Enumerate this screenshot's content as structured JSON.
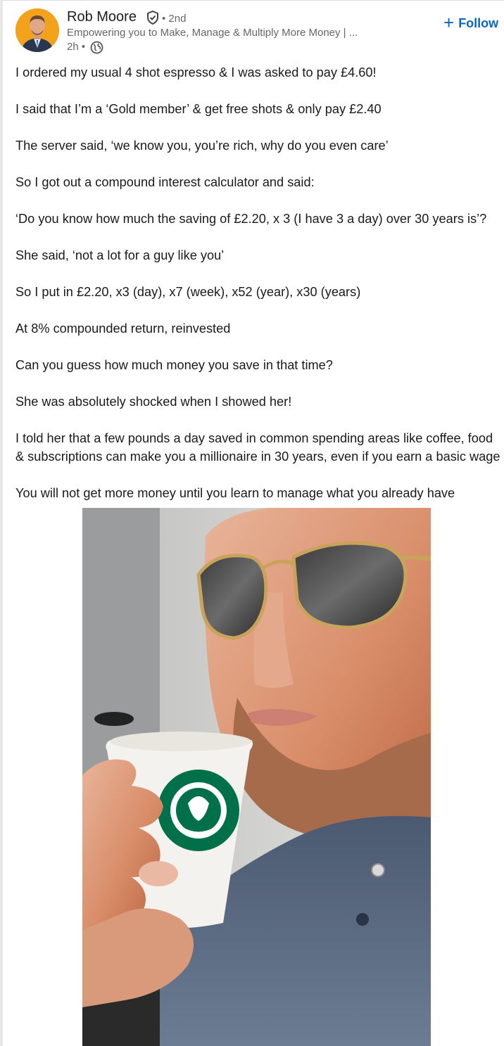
{
  "post": {
    "author": {
      "name": "Rob Moore",
      "connection": "• 2nd",
      "headline": "Empowering you to Make, Manage & Multiply More Money | ...",
      "time": "2h •",
      "verified_icon": "verified-shield-icon",
      "visibility_icon": "globe-icon"
    },
    "follow_label": "Follow",
    "paragraphs": [
      "I ordered my usual 4 shot espresso & I was asked to pay £4.60!",
      "I said that I’m a ‘Gold member’ & get free shots & only pay £2.40",
      "The server said, ‘we know you, you’re rich, why do you even care’",
      "So I got out a compound interest calculator and said:",
      "‘Do you know how much the saving of £2.20, x 3 (I have 3 a day) over 30 years is’?",
      "She said, ‘not a lot for a guy like you’",
      "So I put in £2.20, x3 (day), x7 (week), x52 (year), x30 (years)",
      "At 8% compounded return, reinvested",
      "Can you guess how much money you save in that time?",
      "She was absolutely shocked when I showed her!",
      "I told her that a few pounds a day saved in common spending areas like coffee, food",
      "& subscriptions can make you a millionaire in 30 years, even if you earn a basic wage",
      "You will not get more money until you learn to manage what you already have"
    ],
    "colors": {
      "accent": "#0a66c2",
      "avatar_bg": "#f2a31b",
      "secondary_text": "#666666",
      "starbucks_green": "#00704a"
    }
  }
}
